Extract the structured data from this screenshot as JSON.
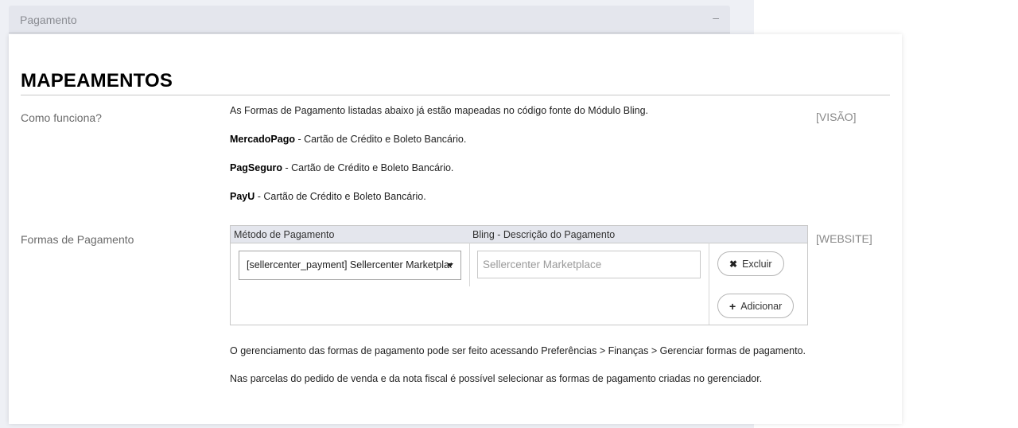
{
  "section": {
    "title": "Pagamento",
    "collapse_symbol": "–"
  },
  "heading": "MAPEAMENTOS",
  "how_it_works": {
    "label": "Como funciona?",
    "scope": "[VISÃO]",
    "intro": "As Formas de Pagamento listadas abaixo já estão mapeadas no código fonte do Módulo Bling.",
    "gateways": [
      {
        "name": "MercadoPago",
        "desc": " - Cartão de Crédito e Boleto Bancário."
      },
      {
        "name": "PagSeguro",
        "desc": " - Cartão de Crédito e Boleto Bancário."
      },
      {
        "name": "PayU",
        "desc": " - Cartão de Crédito e Boleto Bancário."
      }
    ]
  },
  "payment_methods": {
    "label": "Formas de Pagamento",
    "scope": "[WEBSITE]",
    "columns": [
      "Método de Pagamento",
      "Bling - Descrição do Pagamento"
    ],
    "rows": [
      {
        "method": "[sellercenter_payment] Sellercenter Marketplace",
        "description_placeholder": "Sellercenter Marketplace"
      }
    ],
    "delete_label": "Excluir",
    "add_label": "Adicionar",
    "delete_icon": "close-icon",
    "add_icon": "plus-icon",
    "notes": [
      "O gerenciamento das formas de pagamento pode ser feito acessando Preferências > Finanças > Gerenciar formas de pagamento.",
      "Nas parcelas do pedido de venda e da nota fiscal é possível selecionar as formas de pagamento criadas no gerenciador."
    ]
  }
}
